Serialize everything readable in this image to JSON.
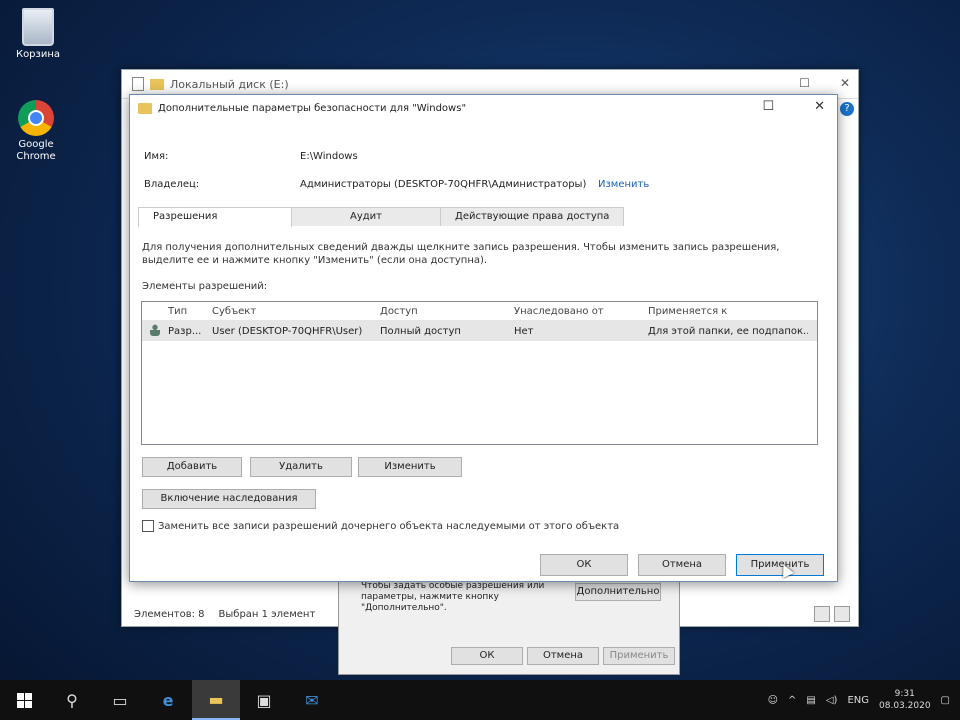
{
  "desktop": {
    "icons": [
      {
        "label": "Корзина"
      },
      {
        "label": "Google Chrome"
      }
    ]
  },
  "explorer": {
    "title": "Локальный диск (E:)",
    "status_items": "Элементов: 8",
    "status_selected": "Выбран 1 элемент"
  },
  "properties": {
    "text": "Чтобы задать особые разрешения или параметры, нажмите кнопку \"Дополнительно\".",
    "advanced_button": "Дополнительно",
    "ok": "ОК",
    "cancel": "Отмена",
    "apply": "Применить"
  },
  "dialog": {
    "title": "Дополнительные параметры безопасности для \"Windows\"",
    "name_label": "Имя:",
    "name_value": "E:\\Windows",
    "owner_label": "Владелец:",
    "owner_value": "Администраторы (DESKTOP-70QHFR\\Администраторы)",
    "owner_change": "Изменить",
    "tabs": [
      {
        "label": "Разрешения"
      },
      {
        "label": "Аудит"
      },
      {
        "label": "Действующие права доступа"
      }
    ],
    "info_text": "Для получения дополнительных сведений дважды щелкните запись разрешения. Чтобы изменить запись разрешения, выделите ее и нажмите кнопку \"Изменить\" (если она доступна).",
    "entries_label": "Элементы разрешений:",
    "columns": [
      "Тип",
      "Субъект",
      "Доступ",
      "Унаследовано от",
      "Применяется к"
    ],
    "rows": [
      {
        "type": "Разр...",
        "subject": "User (DESKTOP-70QHFR\\User)",
        "access": "Полный доступ",
        "inherited": "Нет",
        "applies": "Для этой папки, ее подпапок..."
      }
    ],
    "buttons": {
      "add": "Добавить",
      "remove": "Удалить",
      "edit": "Изменить",
      "enable_inheritance": "Включение наследования"
    },
    "replace_checkbox": "Заменить все записи разрешений дочернего объекта наследуемыми от этого объекта",
    "ok": "ОК",
    "cancel": "Отмена",
    "apply": "Применить"
  },
  "taskbar": {
    "lang": "ENG",
    "time": "9:31",
    "date": "08.03.2020"
  }
}
